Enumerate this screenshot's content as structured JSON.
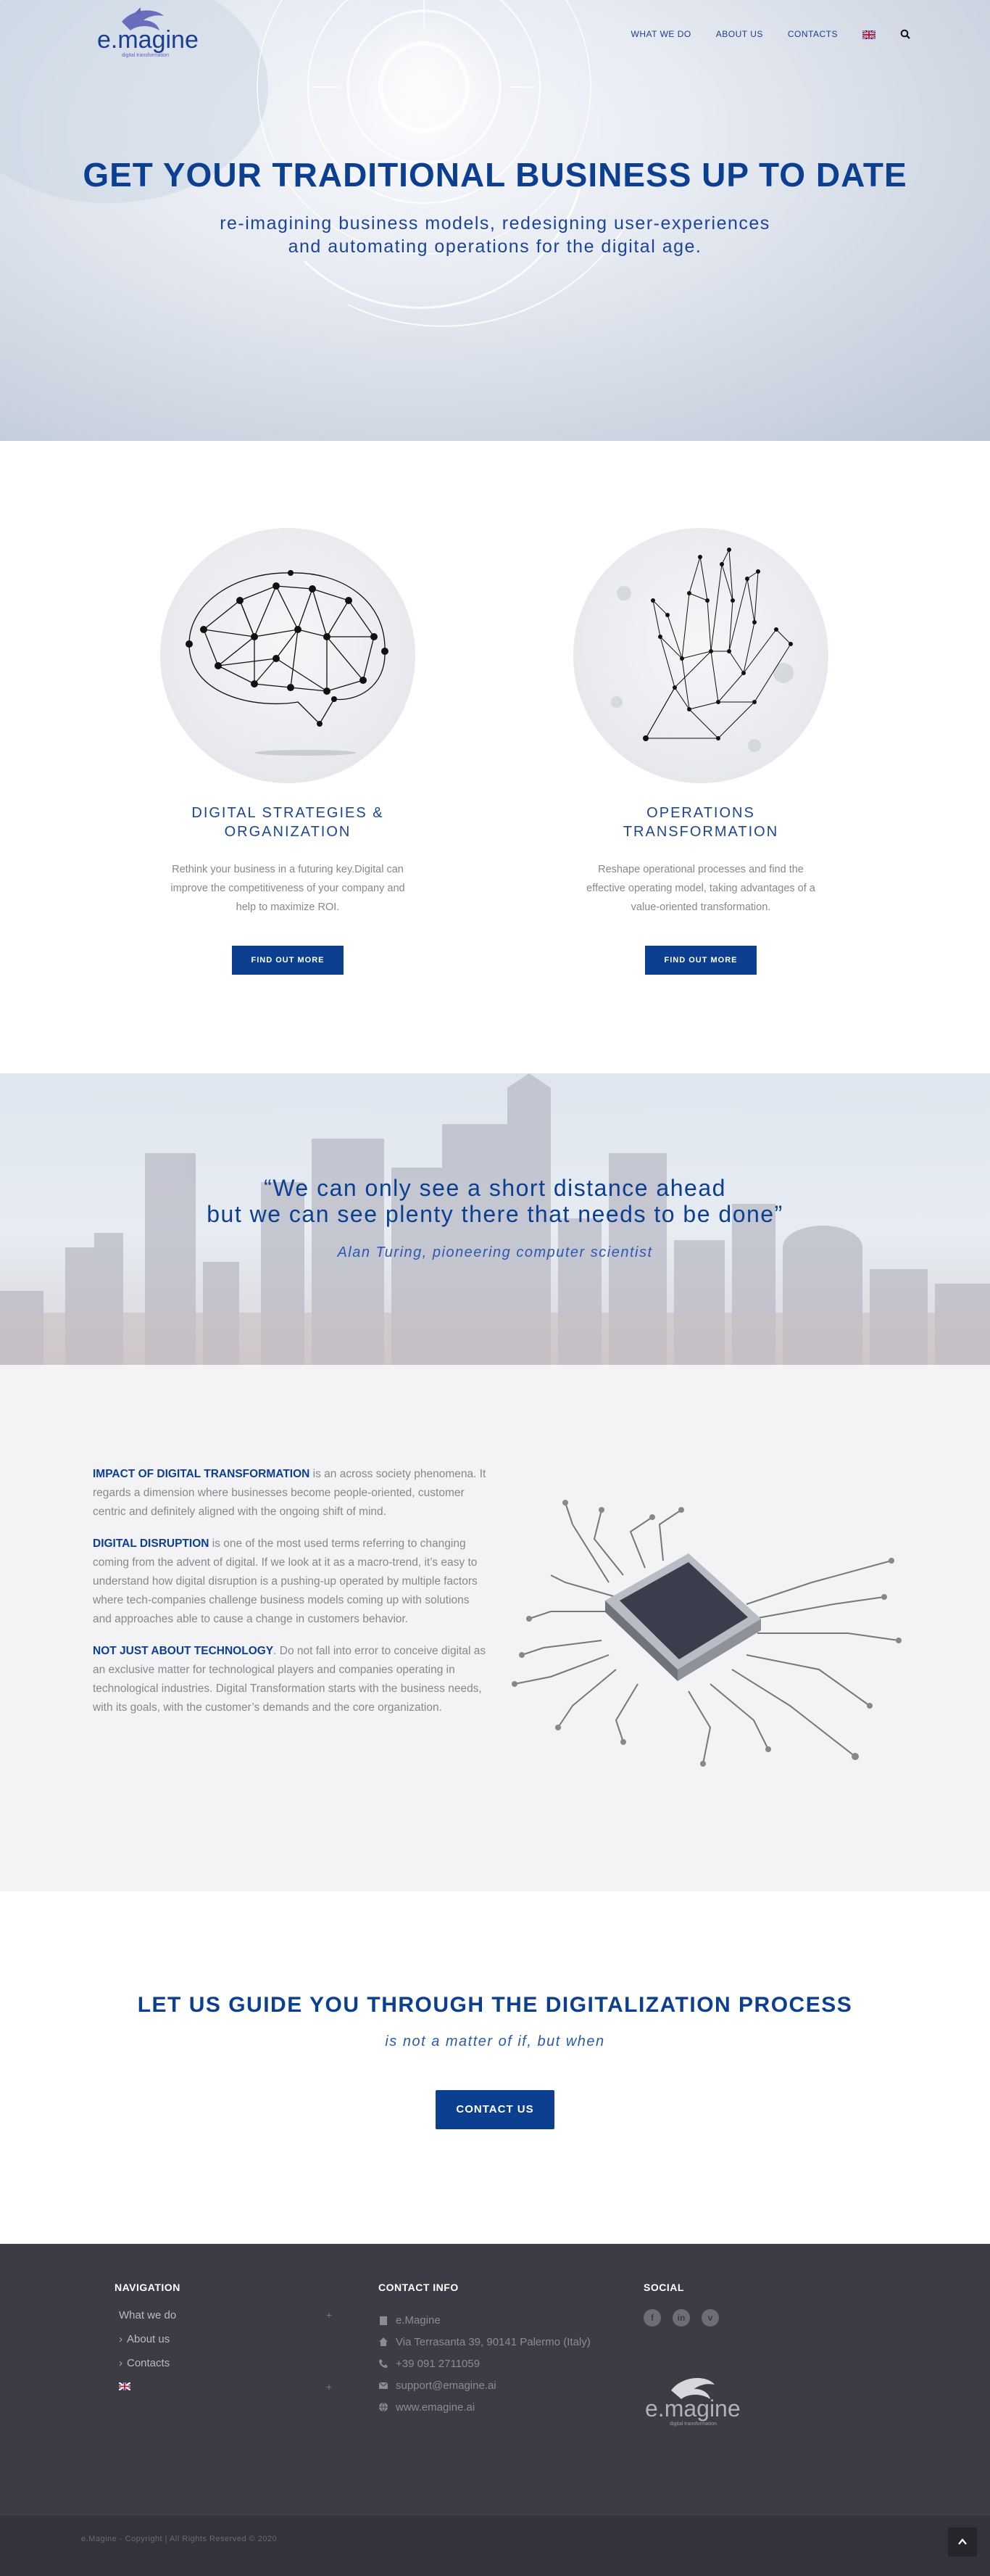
{
  "brand": {
    "logo_text": "e.magine",
    "logo_tagline": "digital transformation"
  },
  "nav": {
    "items": [
      "WHAT WE DO",
      "ABOUT US",
      "CONTACTS"
    ],
    "language_flag": "uk-flag",
    "search_icon": "search-icon"
  },
  "hero": {
    "title": "GET YOUR TRADITIONAL BUSINESS UP TO DATE",
    "subtitle_line1": "re-imagining business models, redesigning user-experiences",
    "subtitle_line2": "and automating operations for the digital age."
  },
  "services": [
    {
      "title_line1": "DIGITAL STRATEGIES &",
      "title_line2": "ORGANIZATION",
      "text": "Rethink your business in a futuring key.Digital can improve the competitiveness of your company and help to maximize ROI.",
      "button": "FIND OUT MORE",
      "image": "brain-network"
    },
    {
      "title_line1": "OPERATIONS",
      "title_line2": "TRANSFORMATION",
      "text": "Reshape operational processes and find the effective operating model, taking advantages of a value-oriented transformation.",
      "button": "FIND OUT MORE",
      "image": "hand-network"
    }
  ],
  "quote": {
    "line1": "“We can only see a short distance ahead",
    "line2": "but we can see plenty there that needs to be done”",
    "author": "Alan Turing, pioneering computer scientist"
  },
  "impact": [
    {
      "heading": "IMPACT OF DIGITAL TRANSFORMATION",
      "text": " is an across society phenomena. It regards a dimension where businesses become people-oriented, customer centric and definitely aligned with the ongoing shift of mind."
    },
    {
      "heading": "DIGITAL DISRUPTION",
      "text": " is one of the most used terms referring to changing coming from the advent of digital. If we look at it as a macro-trend, it’s easy to understand how digital disruption is a pushing-up operated by multiple factors where tech-companies challenge business models coming up with solutions and approaches able to cause a change in customers behavior."
    },
    {
      "heading": "NOT JUST ABOUT TECHNOLOGY",
      "text": ". Do not fall into error to conceive digital as an exclusive matter for technological players and companies operating in technological industries. Digital Transformation starts with the business needs, with its goals, with the customer’s demands and the core organization."
    }
  ],
  "cta": {
    "title": "LET US GUIDE YOU THROUGH THE DIGITALIZATION PROCESS",
    "tagline": "is not a matter of if, but when",
    "button": "CONTACT US"
  },
  "footer": {
    "navigation_title": "NAVIGATION",
    "navigation_items": [
      "What we do",
      "About us",
      "Contacts"
    ],
    "contact_title": "CONTACT INFO",
    "contact": {
      "company": "e.Magine",
      "address": "Via Terrasanta 39, 90141 Palermo (Italy)",
      "phone": "+39 091 2711059",
      "email": "support@emagine.ai",
      "web": "www.emagine.ai"
    },
    "social_title": "SOCIAL",
    "social": [
      "f",
      "in",
      "v"
    ]
  },
  "bottom": {
    "copyright": "e.Magine - Copyright | All Rights Reserved © 2020"
  },
  "colors": {
    "brand_blue": "#0d3f91",
    "footer_bg": "#3d3c45"
  }
}
